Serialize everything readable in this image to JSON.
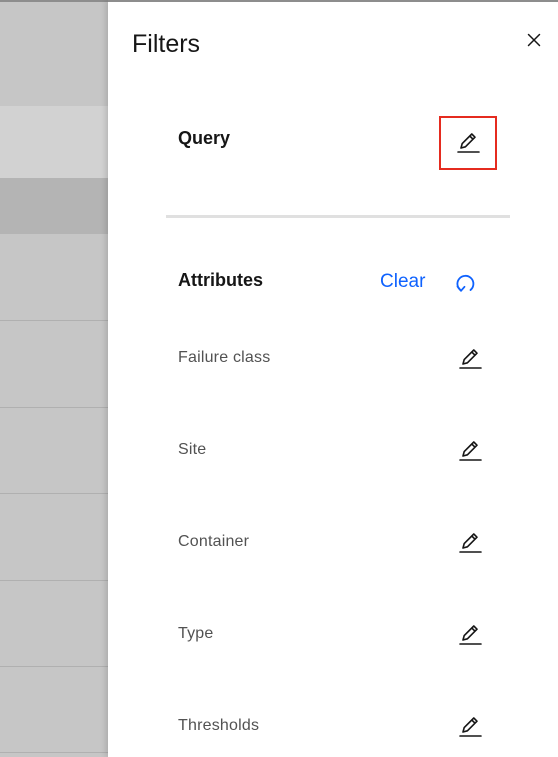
{
  "panel": {
    "title": "Filters"
  },
  "query": {
    "label": "Query"
  },
  "attributes": {
    "title": "Attributes",
    "clear_label": "Clear",
    "items": [
      {
        "label": "Failure class"
      },
      {
        "label": "Site"
      },
      {
        "label": "Container"
      },
      {
        "label": "Type"
      },
      {
        "label": "Thresholds"
      }
    ]
  },
  "colors": {
    "accent_blue": "#0f62fe",
    "highlight_red": "#e52b1f",
    "text_primary": "#161616",
    "text_secondary": "#525252",
    "backdrop_grey": "#c6c6c6"
  },
  "icons": {
    "close": "close-icon",
    "edit": "pencil-icon",
    "reset": "reset-icon"
  }
}
